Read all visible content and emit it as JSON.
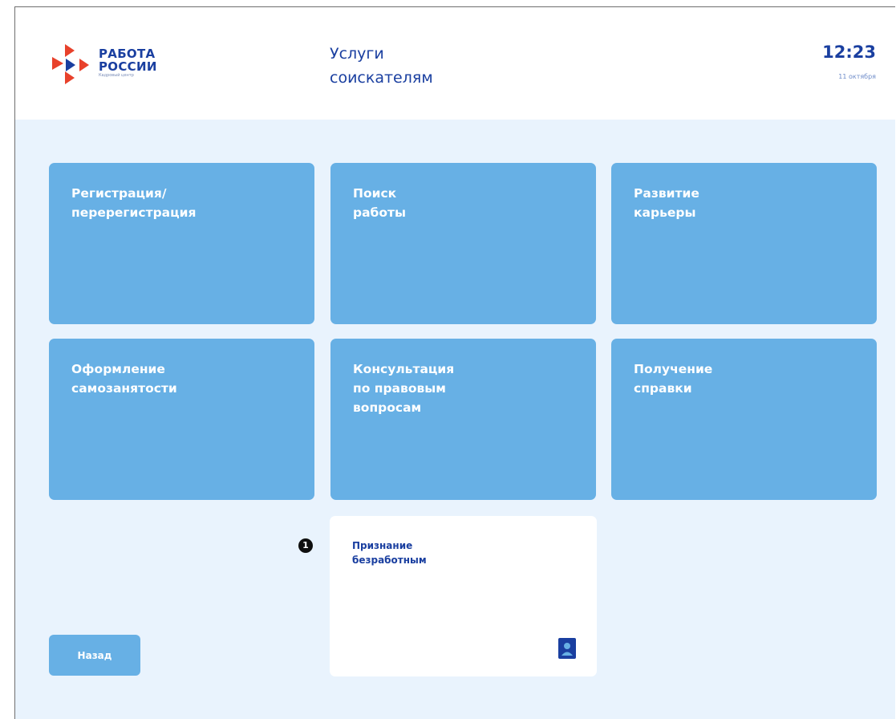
{
  "header": {
    "logo_line1": "РАБОТА",
    "logo_line2": "РОССИИ",
    "logo_sub": "Кадровый центр",
    "title_line1": "Услуги",
    "title_line2": "соискателям",
    "time": "12:23",
    "date": "11 октября",
    "brand_colors": {
      "blue": "#1a3fa0",
      "red": "#e8412b"
    }
  },
  "tiles": [
    {
      "lines": [
        "Регистрация/",
        "перерегистрация"
      ]
    },
    {
      "lines": [
        "Поиск",
        "работы"
      ]
    },
    {
      "lines": [
        "Развитие",
        "карьеры"
      ]
    },
    {
      "lines": [
        "Оформление",
        "самозанятости"
      ]
    },
    {
      "lines": [
        "Консультация",
        "по правовым",
        "вопросам"
      ]
    },
    {
      "lines": [
        "Получение",
        "справки"
      ]
    }
  ],
  "selected_tile": {
    "lines": [
      "Признание",
      "безработным"
    ],
    "icon": "profile-card-icon"
  },
  "marker": "1",
  "back_button": "Назад",
  "colors": {
    "background": "#e9f3fd",
    "tile": "#67b0e5",
    "text_dark": "#1a3fa0"
  }
}
